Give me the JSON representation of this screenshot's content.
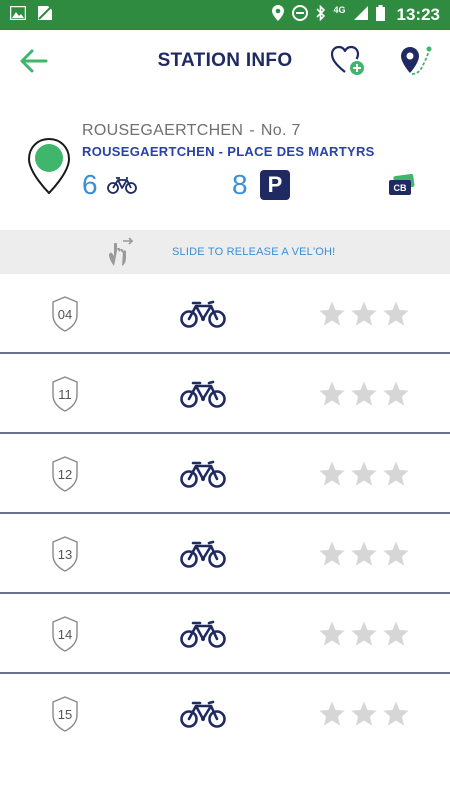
{
  "status_bar": {
    "time": "13:23",
    "network": "4G",
    "icons": [
      "image-icon",
      "no-sim-icon",
      "location-icon",
      "dnd-icon",
      "bluetooth-icon",
      "signal-icon",
      "battery-icon"
    ]
  },
  "toolbar": {
    "title": "STATION INFO",
    "icons": [
      "back-arrow-icon",
      "favorite-add-icon",
      "route-pin-icon"
    ]
  },
  "station": {
    "name": "ROUSEGAERTCHEN",
    "separator": "-",
    "number": "No. 7",
    "address": "ROUSEGAERTCHEN - PLACE DES MARTYRS",
    "bikes_available": "6",
    "parking_available": "8",
    "parking_letter": "P",
    "payment_badge": "CB"
  },
  "slide": {
    "text": "SLIDE TO RELEASE A VEL'OH!"
  },
  "bikes": [
    {
      "stand": "04",
      "rating": 0
    },
    {
      "stand": "11",
      "rating": 0
    },
    {
      "stand": "12",
      "rating": 0
    },
    {
      "stand": "13",
      "rating": 0
    },
    {
      "stand": "14",
      "rating": 0
    },
    {
      "stand": "15",
      "rating": 0
    }
  ],
  "colors": {
    "status_bar": "#2e8b3f",
    "accent_green": "#3fb66b",
    "navy": "#1f2a63",
    "blue": "#3a8fd6",
    "star_empty": "#d6d6d6"
  }
}
